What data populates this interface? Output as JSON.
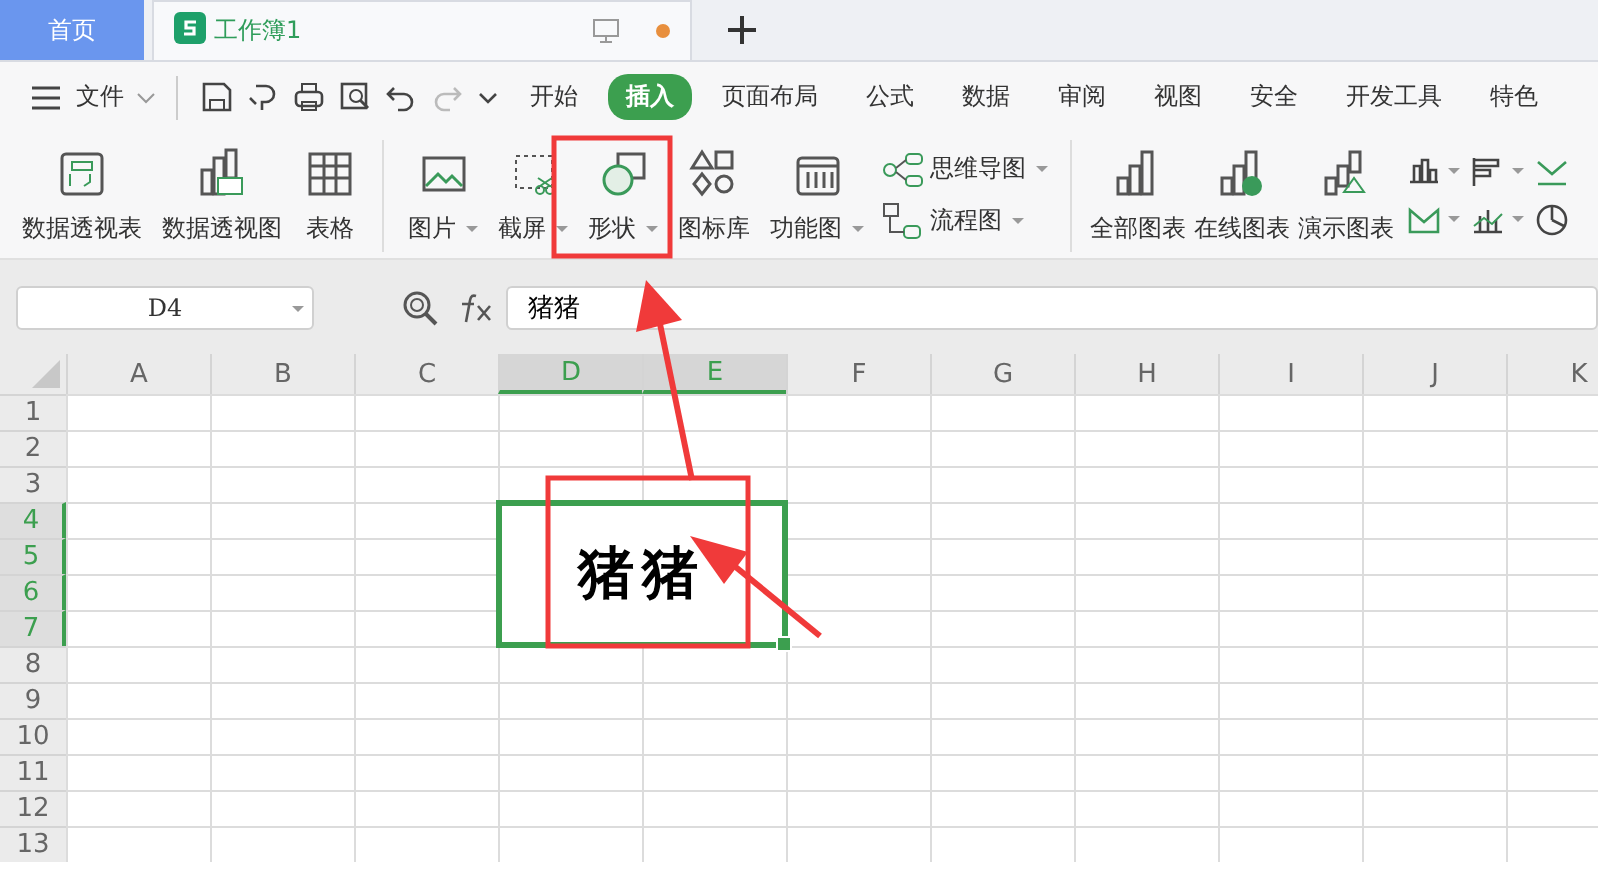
{
  "tabs": [
    {
      "label": "首页",
      "kind": "home",
      "selected": false
    },
    {
      "label": "工作簿1",
      "kind": "doc",
      "selected": true
    }
  ],
  "menu": {
    "file": "文件",
    "tabs": [
      {
        "label": "开始",
        "selected": false
      },
      {
        "label": "插入",
        "selected": true
      },
      {
        "label": "页面布局",
        "selected": false
      },
      {
        "label": "公式",
        "selected": false
      },
      {
        "label": "数据",
        "selected": false
      },
      {
        "label": "审阅",
        "selected": false
      },
      {
        "label": "视图",
        "selected": false
      },
      {
        "label": "安全",
        "selected": false
      },
      {
        "label": "开发工具",
        "selected": false
      },
      {
        "label": "特色",
        "selected": false
      }
    ]
  },
  "ribbon": [
    {
      "kind": "large",
      "label": "数据透视表",
      "dropdown": false
    },
    {
      "kind": "large",
      "label": "数据透视图",
      "dropdown": false
    },
    {
      "kind": "large",
      "label": "表格",
      "dropdown": false
    },
    {
      "kind": "divider"
    },
    {
      "kind": "large",
      "label": "图片",
      "dropdown": true
    },
    {
      "kind": "large",
      "label": "截屏",
      "dropdown": true
    },
    {
      "kind": "large",
      "label": "形状",
      "dropdown": true
    },
    {
      "kind": "large",
      "label": "图标库",
      "dropdown": false
    },
    {
      "kind": "large",
      "label": "功能图",
      "dropdown": true
    },
    {
      "kind": "stack",
      "items": [
        {
          "label": "思维导图",
          "dropdown": true
        },
        {
          "label": "流程图",
          "dropdown": true
        }
      ]
    },
    {
      "kind": "divider"
    },
    {
      "kind": "large",
      "label": "全部图表",
      "dropdown": false
    },
    {
      "kind": "large",
      "label": "在线图表",
      "dropdown": false
    },
    {
      "kind": "large",
      "label": "演示图表",
      "dropdown": false
    }
  ],
  "name_box": "D4",
  "formula": "猪猪",
  "columns": [
    {
      "label": "A",
      "selected": false
    },
    {
      "label": "B",
      "selected": false
    },
    {
      "label": "C",
      "selected": false
    },
    {
      "label": "D",
      "selected": true
    },
    {
      "label": "E",
      "selected": true
    },
    {
      "label": "F",
      "selected": false
    },
    {
      "label": "G",
      "selected": false
    },
    {
      "label": "H",
      "selected": false
    },
    {
      "label": "I",
      "selected": false
    },
    {
      "label": "J",
      "selected": false
    },
    {
      "label": "K",
      "selected": false
    }
  ],
  "rows": [
    {
      "label": "1",
      "selected": false
    },
    {
      "label": "2",
      "selected": false
    },
    {
      "label": "3",
      "selected": false
    },
    {
      "label": "4",
      "selected": true
    },
    {
      "label": "5",
      "selected": true
    },
    {
      "label": "6",
      "selected": true
    },
    {
      "label": "7",
      "selected": true
    },
    {
      "label": "8",
      "selected": false
    },
    {
      "label": "9",
      "selected": false
    },
    {
      "label": "10",
      "selected": false
    },
    {
      "label": "11",
      "selected": false
    },
    {
      "label": "12",
      "selected": false
    },
    {
      "label": "13",
      "selected": false
    }
  ],
  "merged_cell": {
    "text": "猪猪"
  }
}
